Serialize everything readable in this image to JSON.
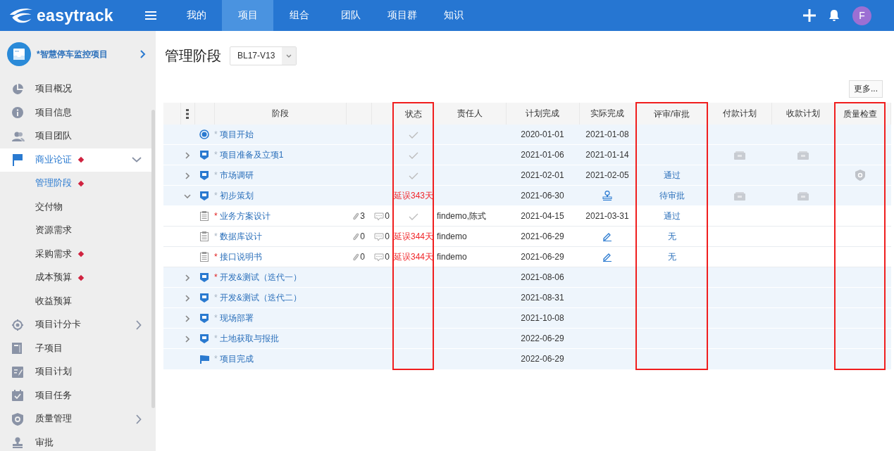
{
  "brand": "easytrack",
  "nav": [
    {
      "label": "我的",
      "selected": false
    },
    {
      "label": "项目",
      "selected": true
    },
    {
      "label": "组合",
      "selected": false
    },
    {
      "label": "团队",
      "selected": false
    },
    {
      "label": "项目群",
      "selected": false
    },
    {
      "label": "知识",
      "selected": false
    }
  ],
  "user_avatar": "F",
  "project": {
    "name": "*智慧停车监控项目"
  },
  "sidebar": {
    "items": [
      {
        "label": "项目概况",
        "kind": "pie",
        "selected": false,
        "badge": false
      },
      {
        "label": "项目信息",
        "kind": "info",
        "selected": false,
        "badge": false
      },
      {
        "label": "项目团队",
        "kind": "people",
        "selected": false,
        "badge": false
      },
      {
        "label": "商业论证",
        "kind": "flag",
        "selected": true,
        "badge": true,
        "expanded": true,
        "children": [
          {
            "label": "管理阶段",
            "selected": true,
            "badge": true
          },
          {
            "label": "交付物",
            "selected": false,
            "badge": false
          },
          {
            "label": "资源需求",
            "selected": false,
            "badge": false
          },
          {
            "label": "采购需求",
            "selected": false,
            "badge": true
          },
          {
            "label": "成本预算",
            "selected": false,
            "badge": true
          },
          {
            "label": "收益预算",
            "selected": false,
            "badge": false
          }
        ]
      },
      {
        "label": "项目计分卡",
        "kind": "target",
        "selected": false,
        "badge": false,
        "expanded": false
      },
      {
        "label": "子项目",
        "kind": "doc",
        "selected": false,
        "badge": false
      },
      {
        "label": "项目计划",
        "kind": "edit",
        "selected": false,
        "badge": false
      },
      {
        "label": "项目任务",
        "kind": "calendar",
        "selected": false,
        "badge": false
      },
      {
        "label": "质量管理",
        "kind": "shield",
        "selected": false,
        "badge": false,
        "expanded": false
      },
      {
        "label": "审批",
        "kind": "stamp",
        "selected": false,
        "badge": false
      }
    ]
  },
  "page": {
    "title": "管理阶段",
    "version": "BL17-V13",
    "more_button": "更多..."
  },
  "table": {
    "columns": [
      {
        "kind": "name",
        "label": "阶段",
        "highlighted": false
      },
      {
        "kind": "attach",
        "highlighted": false
      },
      {
        "kind": "comment",
        "highlighted": false
      },
      {
        "kind": "status",
        "label": "状态",
        "highlighted": true
      },
      {
        "kind": "owner",
        "label": "责任人",
        "highlighted": false
      },
      {
        "kind": "planned",
        "label": "计划完成",
        "highlighted": false
      },
      {
        "kind": "actual",
        "label": "实际完成",
        "highlighted": false
      },
      {
        "kind": "review",
        "label": "评审/审批",
        "highlighted": true
      },
      {
        "kind": "payment",
        "label": "付款计划",
        "highlighted": false
      },
      {
        "kind": "receipt",
        "label": "收款计划",
        "highlighted": false
      },
      {
        "kind": "quality",
        "label": "质量检查",
        "highlighted": true
      }
    ],
    "rows": [
      {
        "kind": "start",
        "name": "项目开始",
        "asterisk": "*",
        "required": false,
        "status": {
          "kind": "check"
        },
        "planned": "2020-01-01",
        "actual": {
          "kind": "text",
          "text": "2021-01-08"
        }
      },
      {
        "kind": "phase",
        "expanded": false,
        "name": "项目准备及立项1",
        "asterisk": "*",
        "required": false,
        "status": {
          "kind": "check"
        },
        "planned": "2021-01-06",
        "actual": {
          "kind": "text",
          "text": "2021-01-14"
        },
        "payment": true,
        "receipt": true
      },
      {
        "kind": "phase",
        "expanded": false,
        "name": "市场调研",
        "asterisk": "*",
        "required": false,
        "status": {
          "kind": "check"
        },
        "planned": "2021-02-01",
        "actual": {
          "kind": "text",
          "text": "2021-02-05"
        },
        "review": "通过",
        "quality": true
      },
      {
        "kind": "phase",
        "expanded": true,
        "name": "初步策划",
        "asterisk": "*",
        "required": false,
        "status": {
          "kind": "delay",
          "text": "延误343天"
        },
        "planned": "2021-06-30",
        "actual": {
          "kind": "stamp"
        },
        "review": "待审批",
        "payment": true,
        "receipt": true,
        "children": [
          {
            "kind": "task",
            "name": "业务方案设计",
            "asterisk": "*",
            "required": true,
            "attachments": "3",
            "comments": "0",
            "status": {
              "kind": "check"
            },
            "owner": "findemo,陈式",
            "planned": "2021-04-15",
            "actual": {
              "kind": "text",
              "text": "2021-03-31"
            },
            "review": "通过"
          },
          {
            "kind": "task",
            "name": "数据库设计",
            "asterisk": "*",
            "required": false,
            "attachments": "0",
            "comments": "0",
            "status": {
              "kind": "delay",
              "text": "延误344天"
            },
            "owner": "findemo",
            "planned": "2021-06-29",
            "actual": {
              "kind": "edit"
            },
            "review": "无"
          },
          {
            "kind": "task",
            "name": "接口说明书",
            "asterisk": "*",
            "required": true,
            "attachments": "0",
            "comments": "0",
            "status": {
              "kind": "delay",
              "text": "延误344天"
            },
            "owner": "findemo",
            "planned": "2021-06-29",
            "actual": {
              "kind": "edit"
            },
            "review": "无"
          }
        ]
      },
      {
        "kind": "phase",
        "expanded": false,
        "name": "开发&测试（迭代一）",
        "asterisk": "*",
        "required": true,
        "planned": "2021-08-06"
      },
      {
        "kind": "phase",
        "expanded": false,
        "name": "开发&测试（迭代二）",
        "asterisk": "*",
        "required": false,
        "planned": "2021-08-31"
      },
      {
        "kind": "phase",
        "expanded": false,
        "name": "现场部署",
        "asterisk": "*",
        "required": false,
        "planned": "2021-10-08"
      },
      {
        "kind": "phase",
        "expanded": false,
        "name": "土地获取与报批",
        "asterisk": "*",
        "required": false,
        "planned": "2022-06-29"
      },
      {
        "kind": "end",
        "name": "项目完成",
        "asterisk": "*",
        "required": false,
        "planned": "2022-06-29"
      }
    ]
  }
}
